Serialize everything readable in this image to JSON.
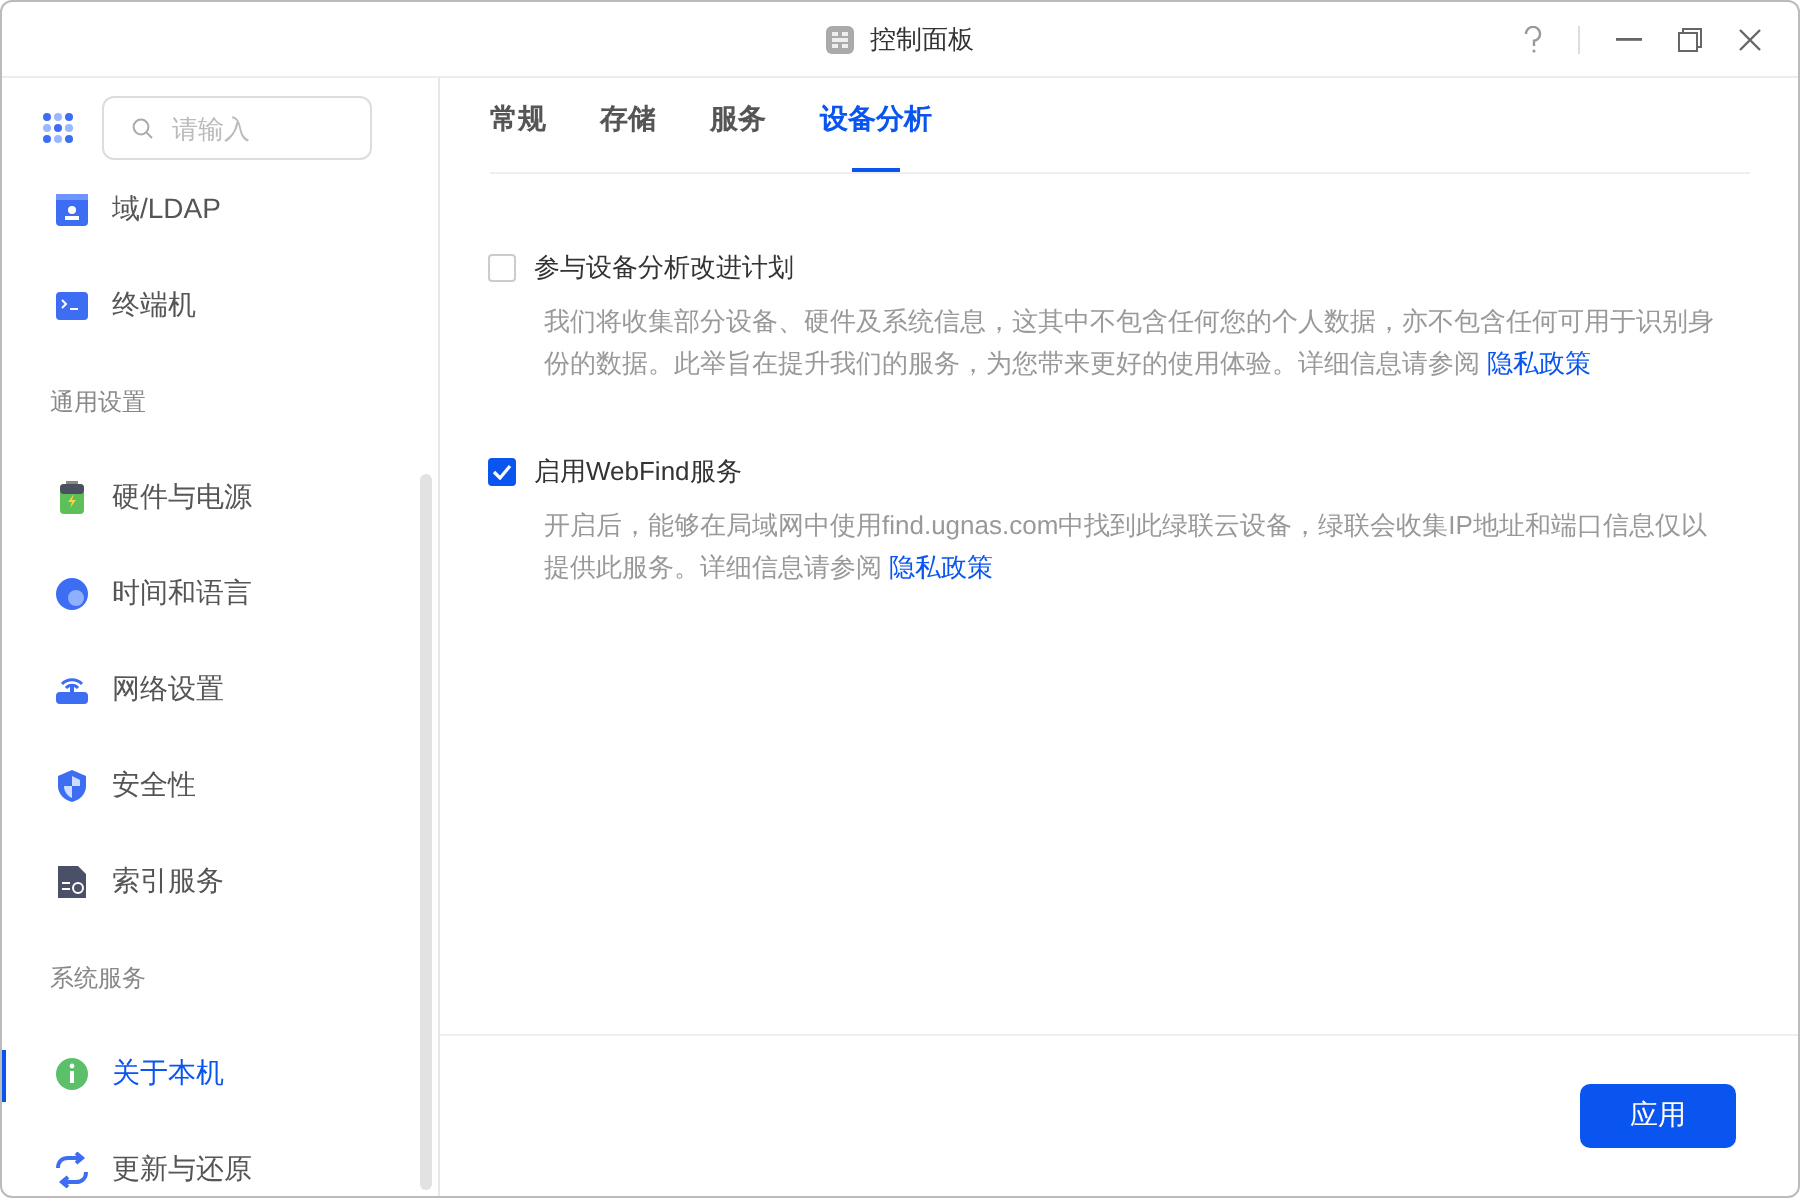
{
  "window": {
    "title": "控制面板"
  },
  "sidebar": {
    "search": {
      "placeholder": "请输入"
    },
    "items": [
      {
        "kind": "item",
        "label": "域/LDAP",
        "selected": false
      },
      {
        "kind": "item",
        "label": "终端机",
        "selected": false
      },
      {
        "kind": "header",
        "label": "通用设置"
      },
      {
        "kind": "item",
        "label": "硬件与电源",
        "selected": false
      },
      {
        "kind": "item",
        "label": "时间和语言",
        "selected": false
      },
      {
        "kind": "item",
        "label": "网络设置",
        "selected": false
      },
      {
        "kind": "item",
        "label": "安全性",
        "selected": false
      },
      {
        "kind": "item",
        "label": "索引服务",
        "selected": false
      },
      {
        "kind": "header",
        "label": "系统服务"
      },
      {
        "kind": "item",
        "label": "关于本机",
        "selected": true
      },
      {
        "kind": "item",
        "label": "更新与还原",
        "selected": false
      }
    ]
  },
  "tabs": [
    {
      "label": "常规",
      "selected": false
    },
    {
      "label": "存储",
      "selected": false
    },
    {
      "label": "服务",
      "selected": false
    },
    {
      "label": "设备分析",
      "selected": true
    }
  ],
  "options": [
    {
      "label": "参与设备分析改进计划",
      "checked": false,
      "description": "我们将收集部分设备、硬件及系统信息，这其中不包含任何您的个人数据，亦不包含任何可用于识别身份的数据。此举旨在提升我们的服务，为您带来更好的使用体验。详细信息请参阅 ",
      "link": "隐私政策"
    },
    {
      "label": "启用WebFind服务",
      "checked": true,
      "description": "开启后，能够在局域网中使用find.ugnas.com中找到此绿联云设备，绿联会收集IP地址和端口信息仅以提供此服务。详细信息请参阅 ",
      "link": "隐私政策"
    }
  ],
  "buttons": [
    "应用"
  ]
}
